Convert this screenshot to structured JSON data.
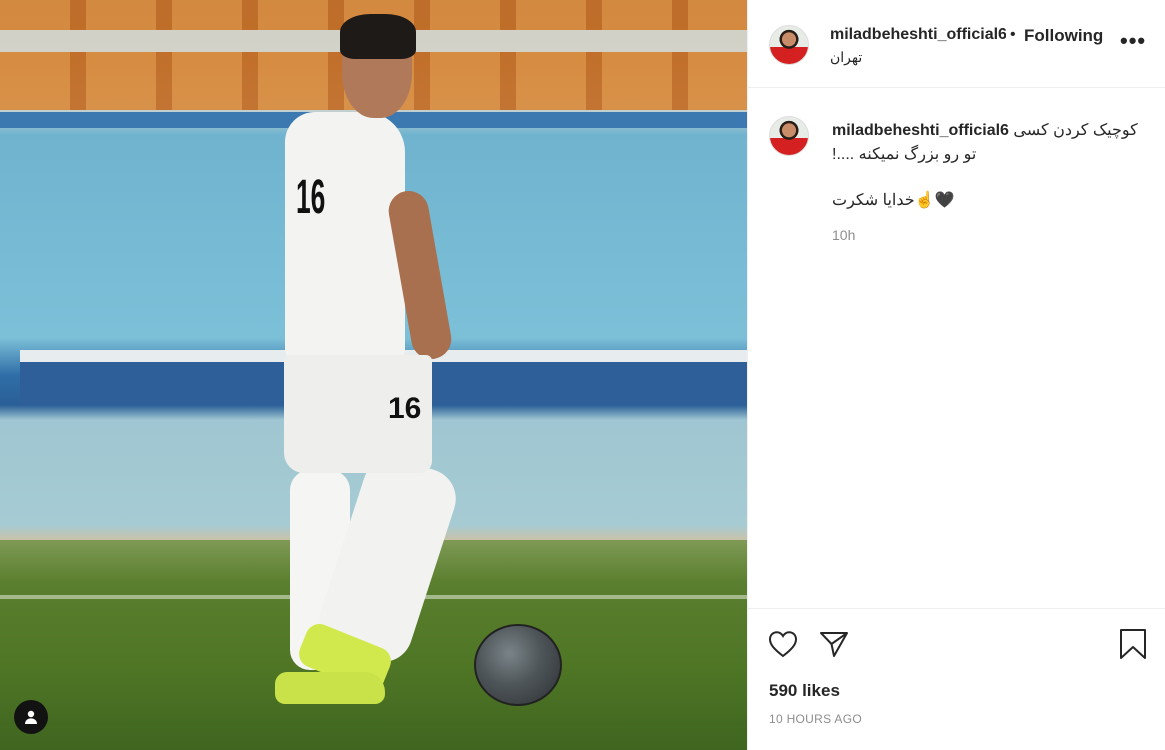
{
  "post": {
    "header": {
      "username": "miladbeheshti_official6",
      "separator": "•",
      "follow_status": "Following",
      "location": "تهران",
      "more_label": "•••"
    },
    "caption": {
      "username": "miladbeheshti_official6",
      "line1": "کوچیک کردن کسی",
      "line2": "تو رو بزرگ نمیکنه ....!",
      "line3": "خدایا شکرت",
      "emoji": "☝️🖤",
      "time": "10h"
    },
    "stats": {
      "likes": "590 likes",
      "time_ago": "10 HOURS AGO"
    },
    "photo": {
      "jersey_number": "16"
    }
  },
  "icons": {
    "like": "heart-icon",
    "share": "paper-plane-icon",
    "save": "bookmark-icon",
    "tags": "user-tag-icon"
  },
  "colors": {
    "text": "#262626",
    "muted": "#8e8e8e",
    "border": "#efefef"
  }
}
